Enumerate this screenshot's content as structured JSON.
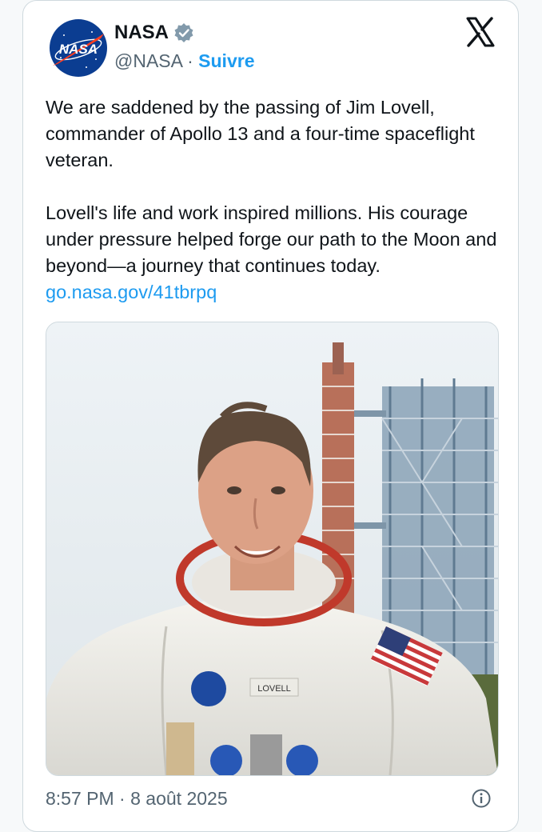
{
  "author": {
    "name": "NASA",
    "handle": "@NASA",
    "separator": " · ",
    "follow_label": "Suivre",
    "avatar_logo_text": "NASA",
    "verified_color": "#829aab"
  },
  "tweet": {
    "paragraph1": "We are saddened by the passing of Jim Lovell, commander of Apollo 13 and a four-time spaceflight veteran.",
    "paragraph2": "Lovell's life and work inspired millions. His courage under pressure helped forge our path to the Moon and beyond—a journey that continues today.",
    "link": "go.nasa.gov/41tbrpq"
  },
  "media": {
    "description": "Portrait photo of astronaut in spacesuit in front of launch tower",
    "suit_nametag": "LOVELL"
  },
  "footer": {
    "time": "8:57 PM",
    "separator": " · ",
    "date": "8 août 2025"
  },
  "colors": {
    "accent": "#1d9bf0",
    "nasa_blue": "#0b3d91",
    "nasa_red": "#fc3d21",
    "text_secondary": "#536471"
  },
  "icons": {
    "platform": "x-logo-icon",
    "info": "info-icon",
    "verified": "verified-badge-icon"
  }
}
